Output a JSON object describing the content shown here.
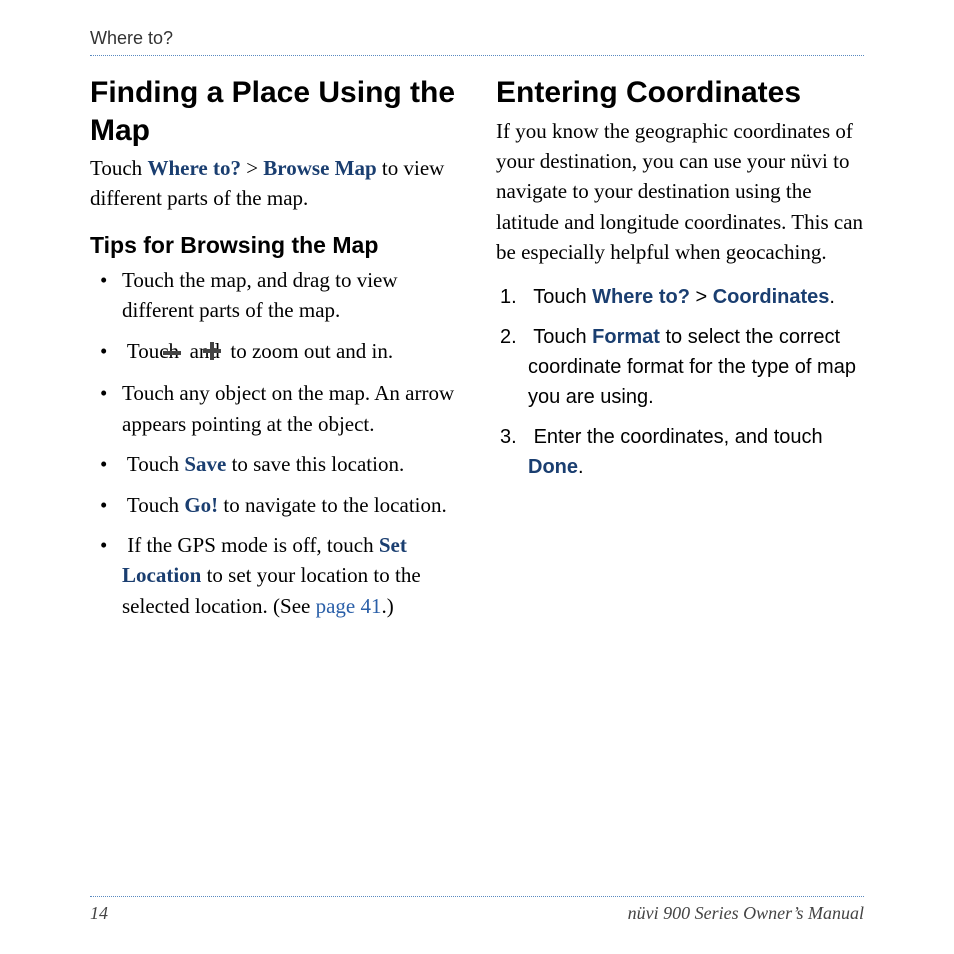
{
  "header": {
    "breadcrumb": "Where to?"
  },
  "left": {
    "h1": "Finding a Place Using the Map",
    "intro": {
      "pre": "Touch ",
      "nav1": "Where to?",
      "sep": " > ",
      "nav2": "Browse Map",
      "post": " to view different parts of the map."
    },
    "h2": "Tips for Browsing the Map",
    "bullets": {
      "b1": "Touch the map, and drag to view different parts of the map.",
      "b2": {
        "pre": "Touch ",
        "mid": " and ",
        "post": " to zoom out and in."
      },
      "b3": "Touch any object on the map. An arrow appears pointing at the object.",
      "b4": {
        "pre": "Touch ",
        "kw": "Save",
        "post": " to save this location."
      },
      "b5": {
        "pre": "Touch ",
        "kw": "Go!",
        "post": " to navigate to the location."
      },
      "b6": {
        "pre": "If the GPS mode is off, touch ",
        "kw": "Set Location",
        "mid": " to set your location to the selected location. (See ",
        "link": "page 41",
        "post": ".)"
      }
    }
  },
  "right": {
    "h1": "Entering Coordinates",
    "intro": "If you know the geographic coordinates of your destination, you can use your nüvi to navigate to your destination using the latitude and longitude coordinates. This can be especially helpful when geocaching.",
    "steps": {
      "s1": {
        "pre": "Touch ",
        "nav1": "Where to?",
        "sep": " > ",
        "nav2": "Coordinates",
        "post": "."
      },
      "s2": {
        "pre": "Touch ",
        "kw": "Format",
        "post": " to select the correct coordinate format for the type of map you are using."
      },
      "s3": {
        "pre": "Enter the coordinates, and touch ",
        "kw": "Done",
        "post": "."
      }
    }
  },
  "footer": {
    "page_number": "14",
    "manual_title": "nüvi 900 Series Owner’s Manual"
  }
}
